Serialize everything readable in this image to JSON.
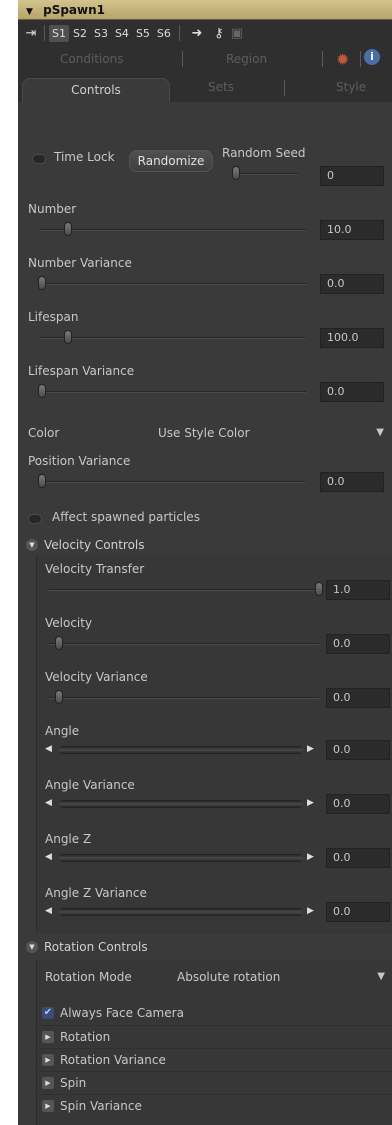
{
  "header": {
    "title": "pSpawn1"
  },
  "toolbar": {
    "slots": [
      "S1",
      "S2",
      "S3",
      "S4",
      "S5",
      "S6"
    ]
  },
  "tabs_top": [
    "Conditions",
    "Region"
  ],
  "tabs_main": [
    "Controls",
    "Sets",
    "Style"
  ],
  "controls": {
    "time_lock": "Time Lock",
    "randomize": "Randomize",
    "random_seed_label": "Random Seed",
    "random_seed_value": "0",
    "number": {
      "label": "Number",
      "value": "10.0"
    },
    "number_variance": {
      "label": "Number Variance",
      "value": "0.0"
    },
    "lifespan": {
      "label": "Lifespan",
      "value": "100.0"
    },
    "lifespan_variance": {
      "label": "Lifespan Variance",
      "value": "0.0"
    },
    "color": {
      "label": "Color",
      "value": "Use Style Color"
    },
    "position_variance": {
      "label": "Position Variance",
      "value": "0.0"
    },
    "affect_spawned": "Affect spawned particles"
  },
  "velocity": {
    "header": "Velocity Controls",
    "transfer": {
      "label": "Velocity Transfer",
      "value": "1.0"
    },
    "velocity": {
      "label": "Velocity",
      "value": "0.0"
    },
    "variance": {
      "label": "Velocity Variance",
      "value": "0.0"
    },
    "angle": {
      "label": "Angle",
      "value": "0.0"
    },
    "angle_variance": {
      "label": "Angle Variance",
      "value": "0.0"
    },
    "angle_z": {
      "label": "Angle Z",
      "value": "0.0"
    },
    "angle_z_variance": {
      "label": "Angle Z Variance",
      "value": "0.0"
    }
  },
  "rotation": {
    "header": "Rotation Controls",
    "mode_label": "Rotation Mode",
    "mode_value": "Absolute rotation",
    "face_camera": "Always Face Camera",
    "items": [
      "Rotation",
      "Rotation Variance",
      "Spin",
      "Spin Variance"
    ]
  },
  "colors": {
    "title_bar": "#c9b87e",
    "panel_bg": "#3a3a3a"
  }
}
